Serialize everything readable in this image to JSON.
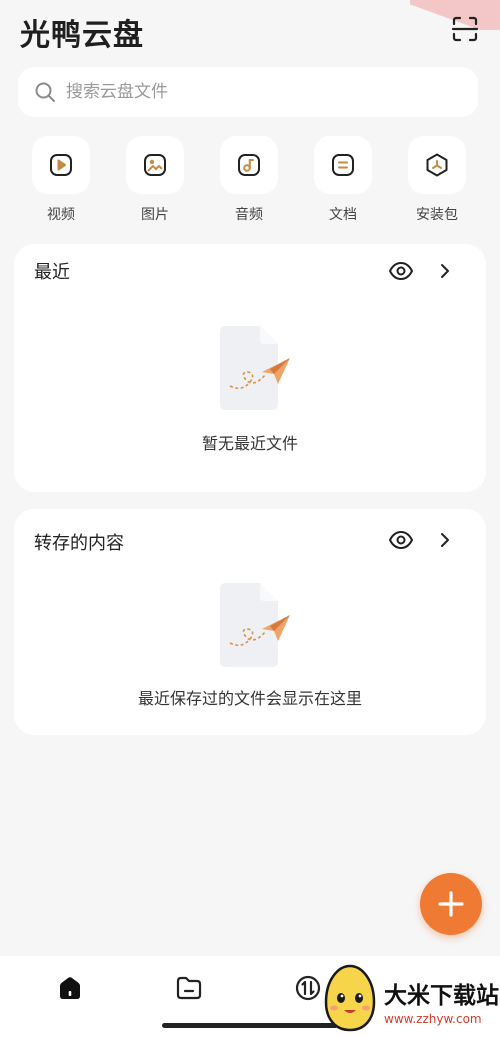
{
  "header": {
    "title": "光鸭云盘",
    "scan_icon": "scan-icon"
  },
  "search": {
    "placeholder": "搜索云盘文件",
    "icon": "search-icon"
  },
  "categories": [
    {
      "label": "视频",
      "icon": "video-icon"
    },
    {
      "label": "图片",
      "icon": "image-icon"
    },
    {
      "label": "音频",
      "icon": "music-icon"
    },
    {
      "label": "文档",
      "icon": "document-icon"
    },
    {
      "label": "安装包",
      "icon": "package-icon"
    }
  ],
  "recent": {
    "title": "最近",
    "empty_text": "暂无最近文件"
  },
  "saved": {
    "title": "转存的内容",
    "empty_text": "最近保存过的文件会显示在这里"
  },
  "fab": {
    "icon": "plus-icon"
  },
  "tabbar": {
    "items": [
      {
        "icon": "home-icon"
      },
      {
        "icon": "folder-icon"
      },
      {
        "icon": "transfer-icon"
      }
    ]
  },
  "watermark": {
    "text": "大米下载站",
    "url": "www.zzhyw.com"
  },
  "colors": {
    "accent": "#ee7a34",
    "category_icon": "#c58a45",
    "background": "#f6f6f7",
    "card": "#ffffff"
  }
}
